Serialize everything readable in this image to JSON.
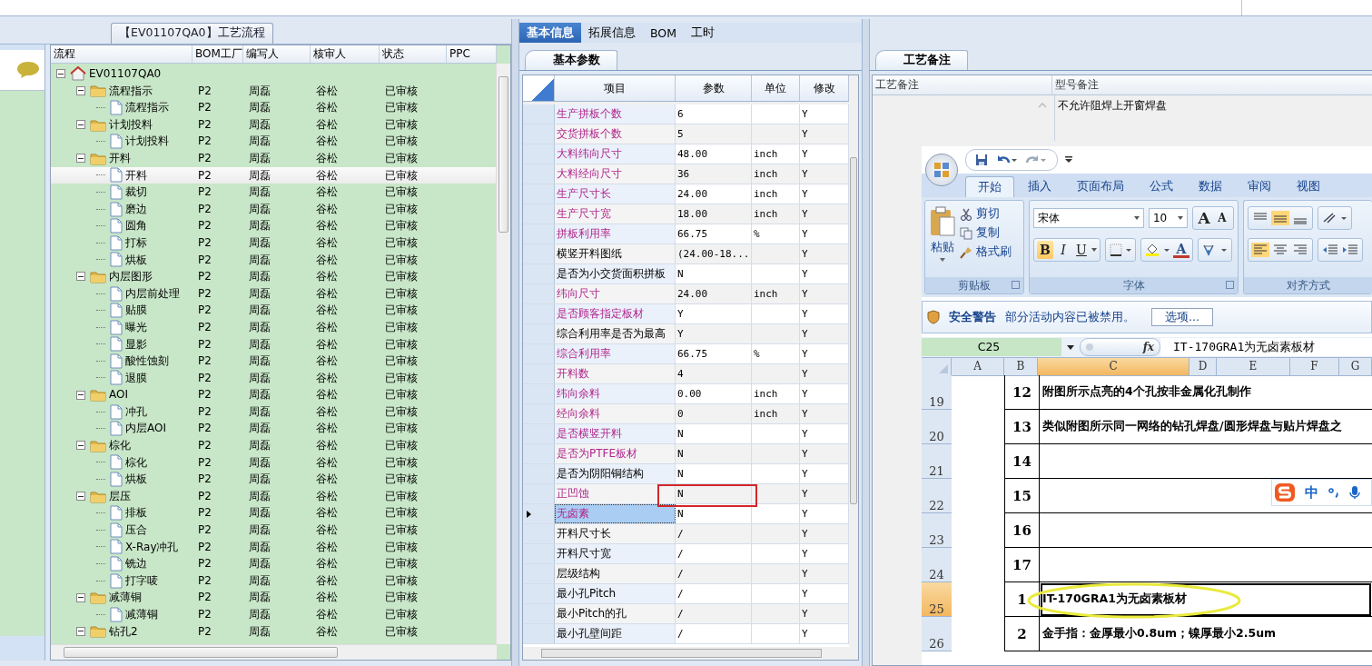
{
  "process_panel": {
    "title": "【EV01107QA0】工艺流程",
    "columns": [
      "流程",
      "BOM工厂",
      "编写人",
      "核审人",
      "状态",
      "PPC"
    ],
    "tree": [
      {
        "kind": "root",
        "label": "EV01107QA0",
        "expanded": true,
        "selected": false,
        "children": [
          {
            "kind": "folder",
            "label": "流程指示",
            "bom_factory": "P2",
            "author": "周磊",
            "reviewer": "谷松",
            "status": "已审核",
            "expanded": true,
            "selected": false,
            "children": [
              {
                "kind": "file",
                "label": "流程指示",
                "bom_factory": "P2",
                "author": "周磊",
                "reviewer": "谷松",
                "status": "已审核",
                "selected": false
              }
            ]
          },
          {
            "kind": "folder",
            "label": "计划投料",
            "bom_factory": "P2",
            "author": "周磊",
            "reviewer": "谷松",
            "status": "已审核",
            "expanded": true,
            "selected": false,
            "children": [
              {
                "kind": "file",
                "label": "计划投料",
                "bom_factory": "P2",
                "author": "周磊",
                "reviewer": "谷松",
                "status": "已审核",
                "selected": false
              }
            ]
          },
          {
            "kind": "folder",
            "label": "开料",
            "bom_factory": "P2",
            "author": "周磊",
            "reviewer": "谷松",
            "status": "已审核",
            "expanded": true,
            "selected": false,
            "children": [
              {
                "kind": "file",
                "label": "开料",
                "bom_factory": "P2",
                "author": "周磊",
                "reviewer": "谷松",
                "status": "已审核",
                "selected": true
              },
              {
                "kind": "file",
                "label": "裁切",
                "bom_factory": "P2",
                "author": "周磊",
                "reviewer": "谷松",
                "status": "已审核",
                "selected": false
              },
              {
                "kind": "file",
                "label": "磨边",
                "bom_factory": "P2",
                "author": "周磊",
                "reviewer": "谷松",
                "status": "已审核",
                "selected": false
              },
              {
                "kind": "file",
                "label": "圆角",
                "bom_factory": "P2",
                "author": "周磊",
                "reviewer": "谷松",
                "status": "已审核",
                "selected": false
              },
              {
                "kind": "file",
                "label": "打标",
                "bom_factory": "P2",
                "author": "周磊",
                "reviewer": "谷松",
                "status": "已审核",
                "selected": false
              },
              {
                "kind": "file",
                "label": "烘板",
                "bom_factory": "P2",
                "author": "周磊",
                "reviewer": "谷松",
                "status": "已审核",
                "selected": false
              }
            ]
          },
          {
            "kind": "folder",
            "label": "内层图形",
            "bom_factory": "P2",
            "author": "周磊",
            "reviewer": "谷松",
            "status": "已审核",
            "expanded": true,
            "selected": false,
            "children": [
              {
                "kind": "file",
                "label": "内层前处理",
                "bom_factory": "P2",
                "author": "周磊",
                "reviewer": "谷松",
                "status": "已审核",
                "selected": false
              },
              {
                "kind": "file",
                "label": "贴膜",
                "bom_factory": "P2",
                "author": "周磊",
                "reviewer": "谷松",
                "status": "已审核",
                "selected": false
              },
              {
                "kind": "file",
                "label": "曝光",
                "bom_factory": "P2",
                "author": "周磊",
                "reviewer": "谷松",
                "status": "已审核",
                "selected": false
              },
              {
                "kind": "file",
                "label": "显影",
                "bom_factory": "P2",
                "author": "周磊",
                "reviewer": "谷松",
                "status": "已审核",
                "selected": false
              },
              {
                "kind": "file",
                "label": "酸性蚀刻",
                "bom_factory": "P2",
                "author": "周磊",
                "reviewer": "谷松",
                "status": "已审核",
                "selected": false
              },
              {
                "kind": "file",
                "label": "退膜",
                "bom_factory": "P2",
                "author": "周磊",
                "reviewer": "谷松",
                "status": "已审核",
                "selected": false
              }
            ]
          },
          {
            "kind": "folder",
            "label": "AOI",
            "bom_factory": "P2",
            "author": "周磊",
            "reviewer": "谷松",
            "status": "已审核",
            "expanded": true,
            "selected": false,
            "children": [
              {
                "kind": "file",
                "label": "冲孔",
                "bom_factory": "P2",
                "author": "周磊",
                "reviewer": "谷松",
                "status": "已审核",
                "selected": false
              },
              {
                "kind": "file",
                "label": "内层AOI",
                "bom_factory": "P2",
                "author": "周磊",
                "reviewer": "谷松",
                "status": "已审核",
                "selected": false
              }
            ]
          },
          {
            "kind": "folder",
            "label": "棕化",
            "bom_factory": "P2",
            "author": "周磊",
            "reviewer": "谷松",
            "status": "已审核",
            "expanded": true,
            "selected": false,
            "children": [
              {
                "kind": "file",
                "label": "棕化",
                "bom_factory": "P2",
                "author": "周磊",
                "reviewer": "谷松",
                "status": "已审核",
                "selected": false
              },
              {
                "kind": "file",
                "label": "烘板",
                "bom_factory": "P2",
                "author": "周磊",
                "reviewer": "谷松",
                "status": "已审核",
                "selected": false
              }
            ]
          },
          {
            "kind": "folder",
            "label": "层压",
            "bom_factory": "P2",
            "author": "周磊",
            "reviewer": "谷松",
            "status": "已审核",
            "expanded": true,
            "selected": false,
            "children": [
              {
                "kind": "file",
                "label": "排板",
                "bom_factory": "P2",
                "author": "周磊",
                "reviewer": "谷松",
                "status": "已审核",
                "selected": false
              },
              {
                "kind": "file",
                "label": "压合",
                "bom_factory": "P2",
                "author": "周磊",
                "reviewer": "谷松",
                "status": "已审核",
                "selected": false
              },
              {
                "kind": "file",
                "label": "X-Ray冲孔",
                "bom_factory": "P2",
                "author": "周磊",
                "reviewer": "谷松",
                "status": "已审核",
                "selected": false
              },
              {
                "kind": "file",
                "label": "铣边",
                "bom_factory": "P2",
                "author": "周磊",
                "reviewer": "谷松",
                "status": "已审核",
                "selected": false
              },
              {
                "kind": "file",
                "label": "打字唛",
                "bom_factory": "P2",
                "author": "周磊",
                "reviewer": "谷松",
                "status": "已审核",
                "selected": false
              }
            ]
          },
          {
            "kind": "folder",
            "label": "减薄铜",
            "bom_factory": "P2",
            "author": "周磊",
            "reviewer": "谷松",
            "status": "已审核",
            "expanded": true,
            "selected": false,
            "children": [
              {
                "kind": "file",
                "label": "减薄铜",
                "bom_factory": "P2",
                "author": "周磊",
                "reviewer": "谷松",
                "status": "已审核",
                "selected": false
              }
            ]
          },
          {
            "kind": "folder",
            "label": "钻孔2",
            "bom_factory": "P2",
            "author": "周磊",
            "reviewer": "谷松",
            "status": "已审核",
            "expanded": true,
            "selected": false
          }
        ]
      }
    ]
  },
  "detail_tabs": [
    {
      "label": "基本信息",
      "selected": true
    },
    {
      "label": "拓展信息",
      "selected": false
    },
    {
      "label": "BOM",
      "selected": false
    },
    {
      "label": "工时",
      "selected": false
    }
  ],
  "parameter_tabs": [
    {
      "label": "基本参数",
      "selected": true
    }
  ],
  "parameters": {
    "columns": [
      "项目",
      "参数",
      "单位",
      "修改"
    ],
    "rows": [
      {
        "item": "生产拼板个数",
        "value": "6",
        "modify": "Y",
        "emphasized": true,
        "selected": false
      },
      {
        "item": "交货拼板个数",
        "value": "5",
        "modify": "Y",
        "emphasized": true,
        "selected": false
      },
      {
        "item": "大料纬向尺寸",
        "value": "48.00",
        "unit": "inch",
        "modify": "Y",
        "emphasized": true,
        "selected": false
      },
      {
        "item": "大料经向尺寸",
        "value": "36",
        "unit": "inch",
        "modify": "Y",
        "emphasized": true,
        "selected": false
      },
      {
        "item": "生产尺寸长",
        "value": "24.00",
        "unit": "inch",
        "modify": "Y",
        "emphasized": true,
        "selected": false
      },
      {
        "item": "生产尺寸宽",
        "value": "18.00",
        "unit": "inch",
        "modify": "Y",
        "emphasized": true,
        "selected": false
      },
      {
        "item": "拼板利用率",
        "value": "66.75",
        "unit": "%",
        "modify": "Y",
        "emphasized": true,
        "selected": false
      },
      {
        "item": "横竖开料图纸",
        "value": "(24.00-18...",
        "modify": "Y",
        "emphasized": false,
        "selected": false
      },
      {
        "item": "是否为小交货面积拼板",
        "value": "N",
        "modify": "Y",
        "emphasized": false,
        "selected": false
      },
      {
        "item": "纬向尺寸",
        "value": "24.00",
        "unit": "inch",
        "modify": "Y",
        "emphasized": true,
        "selected": false
      },
      {
        "item": "是否顾客指定板材",
        "value": "Y",
        "modify": "Y",
        "emphasized": true,
        "selected": false
      },
      {
        "item": "综合利用率是否为最高",
        "value": "Y",
        "modify": "Y",
        "emphasized": false,
        "selected": false
      },
      {
        "item": "综合利用率",
        "value": "66.75",
        "unit": "%",
        "modify": "Y",
        "emphasized": true,
        "selected": false
      },
      {
        "item": "开料数",
        "value": "4",
        "modify": "Y",
        "emphasized": true,
        "selected": false
      },
      {
        "item": "纬向余料",
        "value": "0.00",
        "unit": "inch",
        "modify": "Y",
        "emphasized": true,
        "selected": false
      },
      {
        "item": "经向余料",
        "value": "0",
        "unit": "inch",
        "modify": "Y",
        "emphasized": true,
        "selected": false
      },
      {
        "item": "是否横竖开料",
        "value": "N",
        "modify": "Y",
        "emphasized": true,
        "selected": false
      },
      {
        "item": "是否为PTFE板材",
        "value": "N",
        "modify": "Y",
        "emphasized": true,
        "selected": false
      },
      {
        "item": "是否为阴阳铜结构",
        "value": "N",
        "modify": "Y",
        "emphasized": false,
        "selected": false
      },
      {
        "item": "正凹蚀",
        "value": "N",
        "modify": "Y",
        "emphasized": true,
        "selected": false
      },
      {
        "item": "无卤素",
        "value": "N",
        "modify": "Y",
        "emphasized": true,
        "selected": true
      },
      {
        "item": "开料尺寸长",
        "value": "/",
        "modify": "Y",
        "emphasized": false,
        "selected": false
      },
      {
        "item": "开料尺寸宽",
        "value": "/",
        "modify": "Y",
        "emphasized": false,
        "selected": false
      },
      {
        "item": "层级结构",
        "value": "/",
        "modify": "Y",
        "emphasized": false,
        "selected": false
      },
      {
        "item": "最小孔Pitch",
        "value": "/",
        "modify": "Y",
        "emphasized": false,
        "selected": false
      },
      {
        "item": "最小Pitch的孔",
        "value": "/",
        "modify": "Y",
        "emphasized": false,
        "selected": false
      },
      {
        "item": "最小孔壁间距",
        "value": "/",
        "modify": "Y",
        "emphasized": false,
        "selected": false
      }
    ]
  },
  "remark_tabs": [
    {
      "label": "工艺备注",
      "selected": true
    }
  ],
  "remarks": {
    "columns": [
      "工艺备注",
      "型号备注"
    ],
    "model_remark": "不允许阻焊上开窗焊盘"
  },
  "excel": {
    "ribbon_tabs": [
      {
        "label": "开始",
        "selected": true
      },
      {
        "label": "插入",
        "selected": false
      },
      {
        "label": "页面布局",
        "selected": false
      },
      {
        "label": "公式",
        "selected": false
      },
      {
        "label": "数据",
        "selected": false
      },
      {
        "label": "审阅",
        "selected": false
      },
      {
        "label": "视图",
        "selected": false
      }
    ],
    "clipboard": {
      "paste": "粘贴",
      "cut": "剪切",
      "copy": "复制",
      "format_painter": "格式刷",
      "group": "剪贴板"
    },
    "font": {
      "name": "宋体",
      "size": "10",
      "group": "字体",
      "size_buttons": [
        {
          "kind": "grow",
          "label": "A"
        },
        {
          "kind": "shrink",
          "label": "A"
        }
      ],
      "style_buttons": [
        {
          "kind": "bold",
          "label": "B",
          "on": true
        },
        {
          "kind": "italic",
          "label": "I",
          "on": false
        },
        {
          "kind": "underline",
          "label": "U",
          "on": false
        }
      ],
      "font_color": "A"
    },
    "alignment": {
      "group": "对齐方式",
      "vertical_buttons": [
        {
          "kind": "top",
          "on": false
        },
        {
          "kind": "middle",
          "on": true
        },
        {
          "kind": "bottom",
          "on": false
        }
      ],
      "horizontal_buttons": [
        {
          "kind": "left",
          "on": true
        },
        {
          "kind": "center",
          "on": false
        },
        {
          "kind": "right",
          "on": false
        }
      ]
    },
    "security_bar": {
      "title": "安全警告",
      "message": "部分活动内容已被禁用。",
      "button": "选项..."
    },
    "name_box": "C25",
    "function_button": "fx",
    "formula": "IT-170GRA1为无卤素板材",
    "columns": [
      {
        "label": "A",
        "selected": false
      },
      {
        "label": "B",
        "selected": false
      },
      {
        "label": "C",
        "selected": true
      },
      {
        "label": "D",
        "selected": false
      },
      {
        "label": "E",
        "selected": false
      },
      {
        "label": "F",
        "selected": false
      },
      {
        "label": "G",
        "selected": false
      }
    ],
    "rows": [
      {
        "number": "19",
        "seq": "12",
        "text": "附图所示点亮的4个孔按非金属化孔制作",
        "selected": false
      },
      {
        "number": "20",
        "seq": "13",
        "text": "类似附图所示同一网络的钻孔焊盘/圆形焊盘与贴片焊盘之",
        "selected": false
      },
      {
        "number": "21",
        "seq": "14",
        "selected": false
      },
      {
        "number": "22",
        "seq": "15",
        "selected": false
      },
      {
        "number": "23",
        "seq": "16",
        "selected": false
      },
      {
        "number": "24",
        "seq": "17",
        "selected": false
      },
      {
        "number": "25",
        "seq": "1",
        "text": "IT-170GRA1为无卤素板材",
        "selected": true
      },
      {
        "number": "26",
        "seq": "2",
        "text": "金手指：金厚最小0.8um；镍厚最小2.5um",
        "selected": false
      }
    ],
    "ime": {
      "label": "中"
    }
  }
}
